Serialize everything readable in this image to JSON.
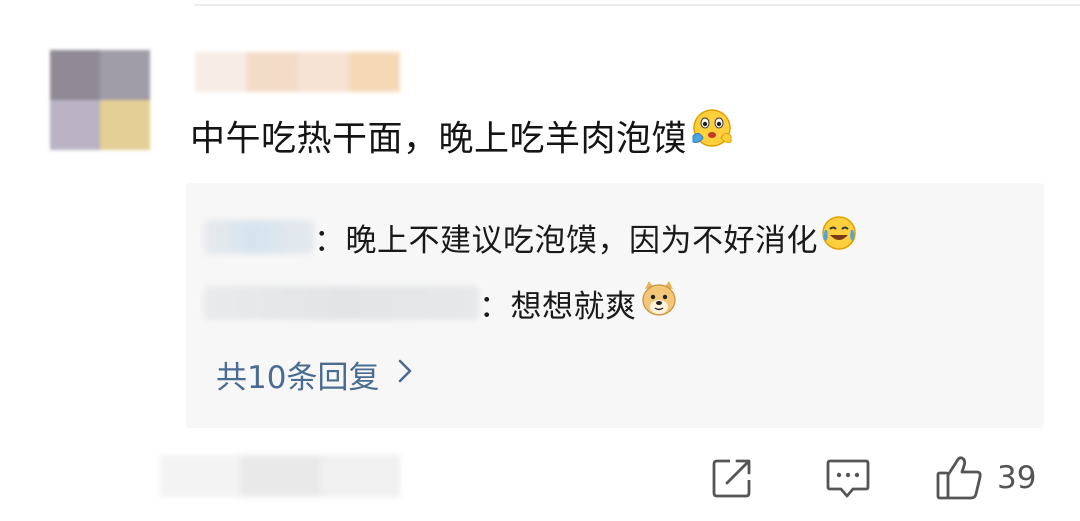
{
  "comment": {
    "text": "中午吃热干面，晚上吃羊肉泡馍"
  },
  "replies": [
    {
      "text": "：晚上不建议吃泡馍，因为不好消化",
      "emoji": "laughing-tears-emoji"
    },
    {
      "text": "：想想就爽",
      "emoji": "doge-emoji"
    }
  ],
  "more_replies": {
    "label": "共10条回复",
    "chevron": "chevron-right-icon"
  },
  "actions": {
    "share_icon": "share-icon",
    "comment_icon": "comment-icon",
    "like_icon": "thumbs-up-icon",
    "like_count": "39"
  },
  "colors": {
    "link": "#4a6c92",
    "reply_bg": "#f7f7f7",
    "icon": "#555555"
  }
}
